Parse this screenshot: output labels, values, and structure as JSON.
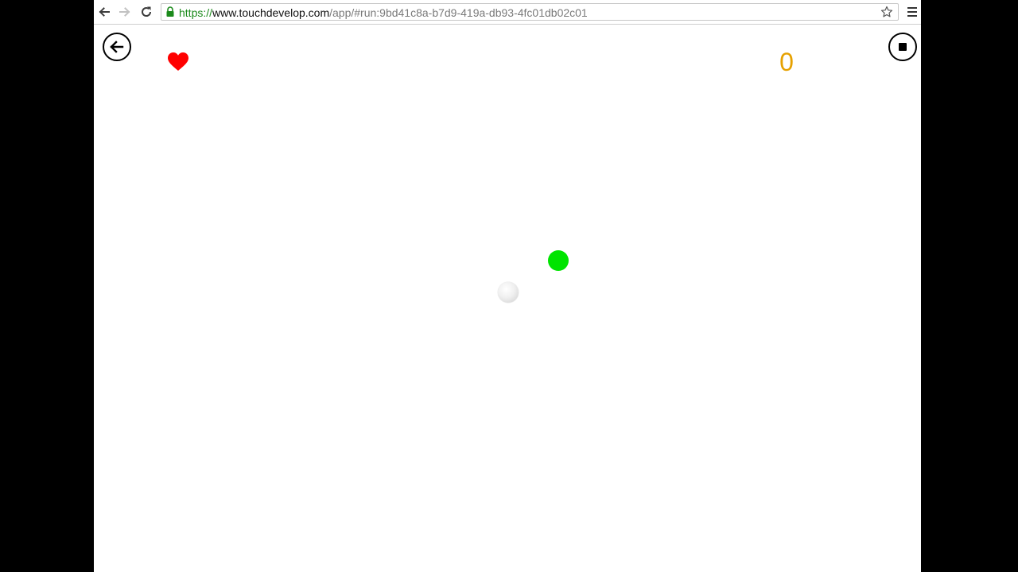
{
  "browser": {
    "url": {
      "scheme": "https://",
      "host": "www.touchdevelop.com",
      "path": "/app/#run:9bd41c8a-b7d9-419a-db93-4fc01db02c01"
    },
    "icons": {
      "back": "arrow-left-icon",
      "forward": "arrow-right-icon",
      "reload": "reload-icon",
      "lock": "lock-icon",
      "bookmark": "star-icon",
      "menu": "hamburger-menu-icon"
    },
    "colors": {
      "secure_scheme": "#1b8a1b"
    }
  },
  "game": {
    "score": "0",
    "icons": {
      "back": "back-arrow-icon",
      "stop": "stop-icon",
      "life": "heart-icon"
    },
    "colors": {
      "score": "#e6a100",
      "heart": "#ff0000",
      "green_ball": "#00e400",
      "white_ball": "#eeeeee"
    }
  }
}
